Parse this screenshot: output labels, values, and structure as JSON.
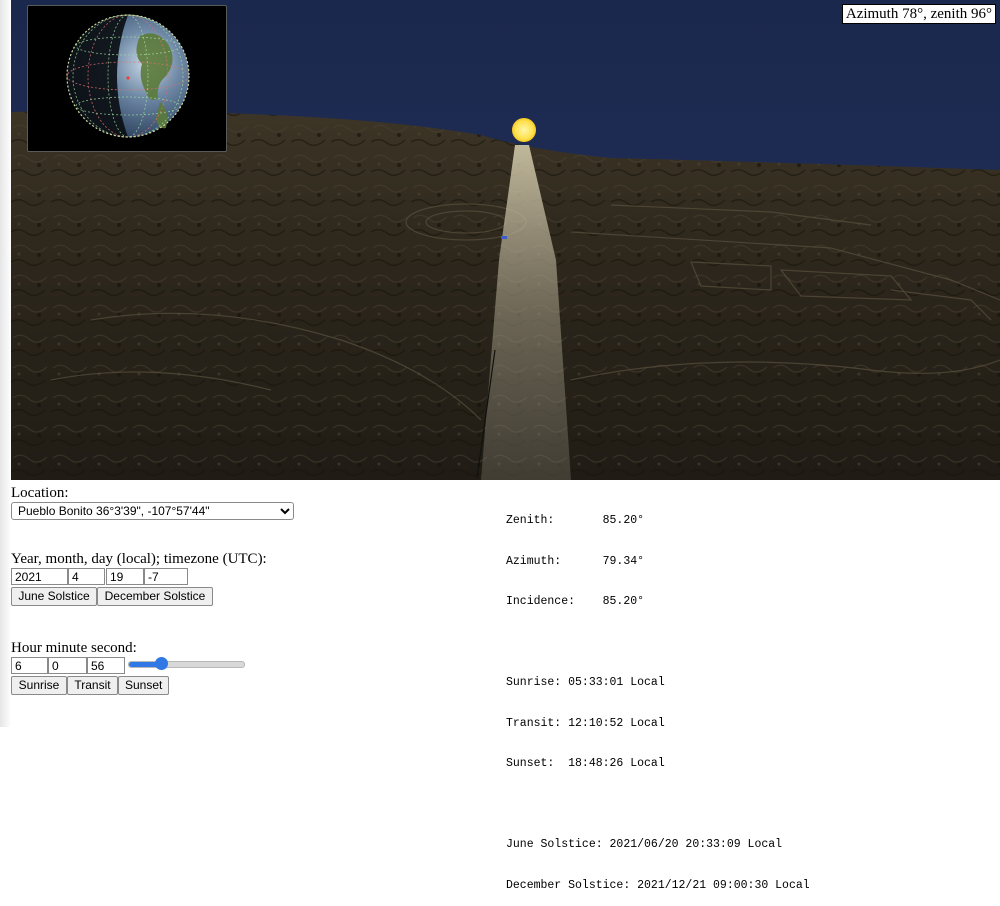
{
  "scene": {
    "readout": "Azimuth 78°, zenith 96°",
    "sky_color": "#1c2a52",
    "sun_color": "#ffe36b"
  },
  "controls": {
    "location_label": "Location:",
    "location_value": "Pueblo Bonito 36°3'39\", -107°57'44\"",
    "date_label": "Year, month, day (local); timezone (UTC):",
    "year": "2021",
    "month": "4",
    "day": "19",
    "timezone": "-7",
    "june_solstice_label": "June Solstice",
    "december_solstice_label": "December Solstice",
    "time_label": "Hour minute second:",
    "hour": "6",
    "minute": "0",
    "second": "56",
    "time_slider_fraction": 0.28,
    "sunrise_label": "Sunrise",
    "transit_label": "Transit",
    "sunset_label": "Sunset"
  },
  "output": {
    "zenith": "Zenith:       85.20°",
    "azimuth": "Azimuth:      79.34°",
    "incidence": "Incidence:    85.20°",
    "sunrise": "Sunrise: 05:33:01 Local",
    "transit": "Transit: 12:10:52 Local",
    "sunset": "Sunset:  18:48:26 Local",
    "june_solstice": "June Solstice: 2021/06/20 20:33:09 Local",
    "december_solstice": "December Solstice: 2021/12/21 09:00:30 Local"
  }
}
